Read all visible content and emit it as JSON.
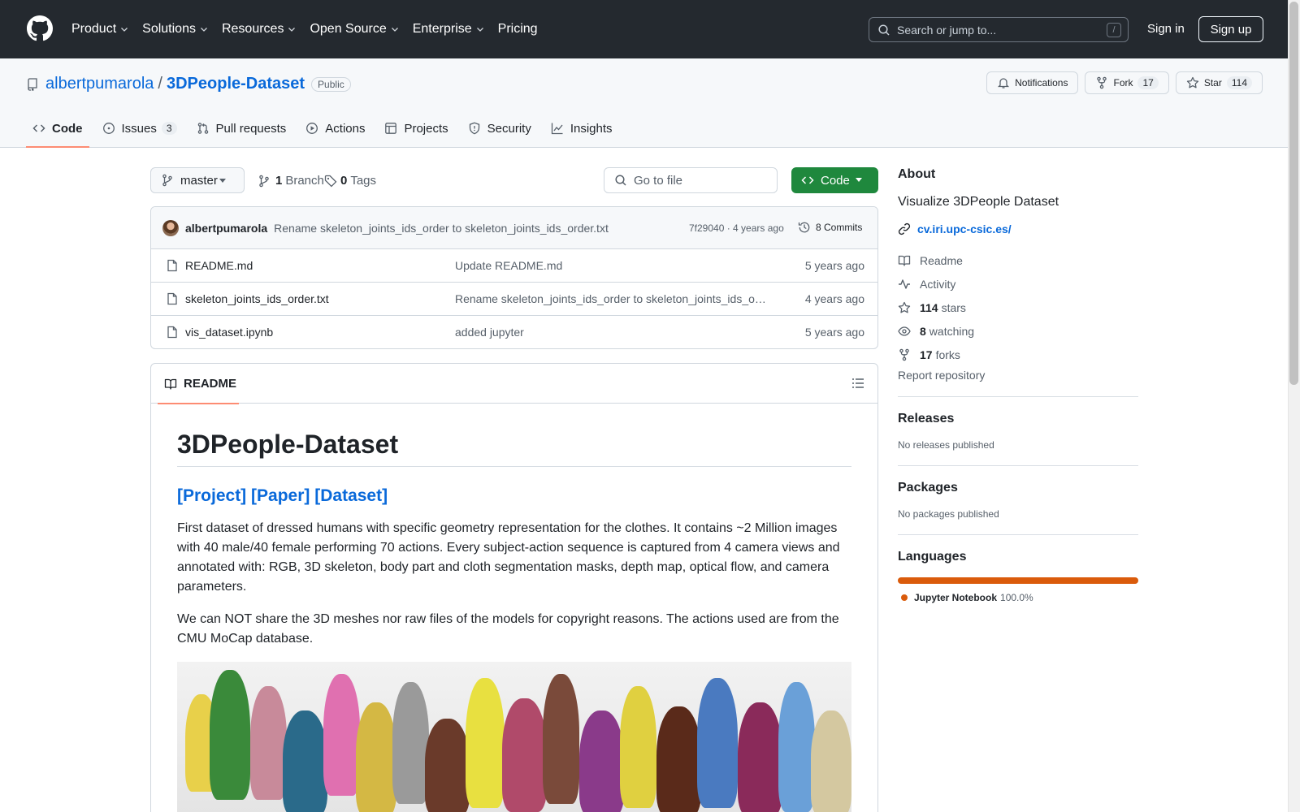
{
  "header": {
    "nav": [
      "Product",
      "Solutions",
      "Resources",
      "Open Source",
      "Enterprise",
      "Pricing"
    ],
    "search_placeholder": "Search or jump to...",
    "search_shortcut": "/",
    "signin": "Sign in",
    "signup": "Sign up"
  },
  "repo": {
    "owner": "albertpumarola",
    "name": "3DPeople-Dataset",
    "visibility": "Public",
    "notifications_label": "Notifications",
    "fork_label": "Fork",
    "fork_count": "17",
    "star_label": "Star",
    "star_count": "114"
  },
  "tabs": {
    "code": "Code",
    "issues": "Issues",
    "issues_count": "3",
    "pulls": "Pull requests",
    "actions": "Actions",
    "projects": "Projects",
    "security": "Security",
    "insights": "Insights"
  },
  "filebar": {
    "branch": "master",
    "branch_count": "1",
    "branch_label": "Branch",
    "tag_count": "0",
    "tag_label": "Tags",
    "goto_placeholder": "Go to file",
    "code_button": "Code"
  },
  "commit": {
    "author": "albertpumarola",
    "message": "Rename skeleton_joints_ids_order to skeleton_joints_ids_order.txt",
    "sha_age": "7f29040 · 4 years ago",
    "commits": "8 Commits"
  },
  "files": [
    {
      "name": "README.md",
      "message": "Update README.md",
      "age": "5 years ago"
    },
    {
      "name": "skeleton_joints_ids_order.txt",
      "message": "Rename skeleton_joints_ids_order to skeleton_joints_ids_order.txt",
      "age": "4 years ago"
    },
    {
      "name": "vis_dataset.ipynb",
      "message": "added jupyter",
      "age": "5 years ago"
    }
  ],
  "readme": {
    "tab": "README",
    "title": "3DPeople-Dataset",
    "links": [
      "[Project]",
      "[Paper]",
      "[Dataset]"
    ],
    "p1": "First dataset of dressed humans with specific geometry representation for the clothes. It contains ~2 Million images with 40 male/40 female performing 70 actions. Every subject-action sequence is captured from 4 camera views and annotated with: RGB, 3D skeleton, body part and cloth segmentation masks, depth map, optical flow, and camera parameters.",
    "p2": "We can NOT share the 3D meshes nor raw files of the models for copyright reasons. The actions used are from the CMU MoCap database."
  },
  "about": {
    "title": "About",
    "description": "Visualize 3DPeople Dataset",
    "website": "cv.iri.upc-csic.es/",
    "readme": "Readme",
    "activity": "Activity",
    "stars_count": "114",
    "stars_label": "stars",
    "watching_count": "8",
    "watching_label": "watching",
    "forks_count": "17",
    "forks_label": "forks",
    "report": "Report repository"
  },
  "releases": {
    "title": "Releases",
    "none": "No releases published"
  },
  "packages": {
    "title": "Packages",
    "none": "No packages published"
  },
  "languages": {
    "title": "Languages",
    "name": "Jupyter Notebook",
    "percent": "100.0%",
    "color": "#da5b0b"
  }
}
